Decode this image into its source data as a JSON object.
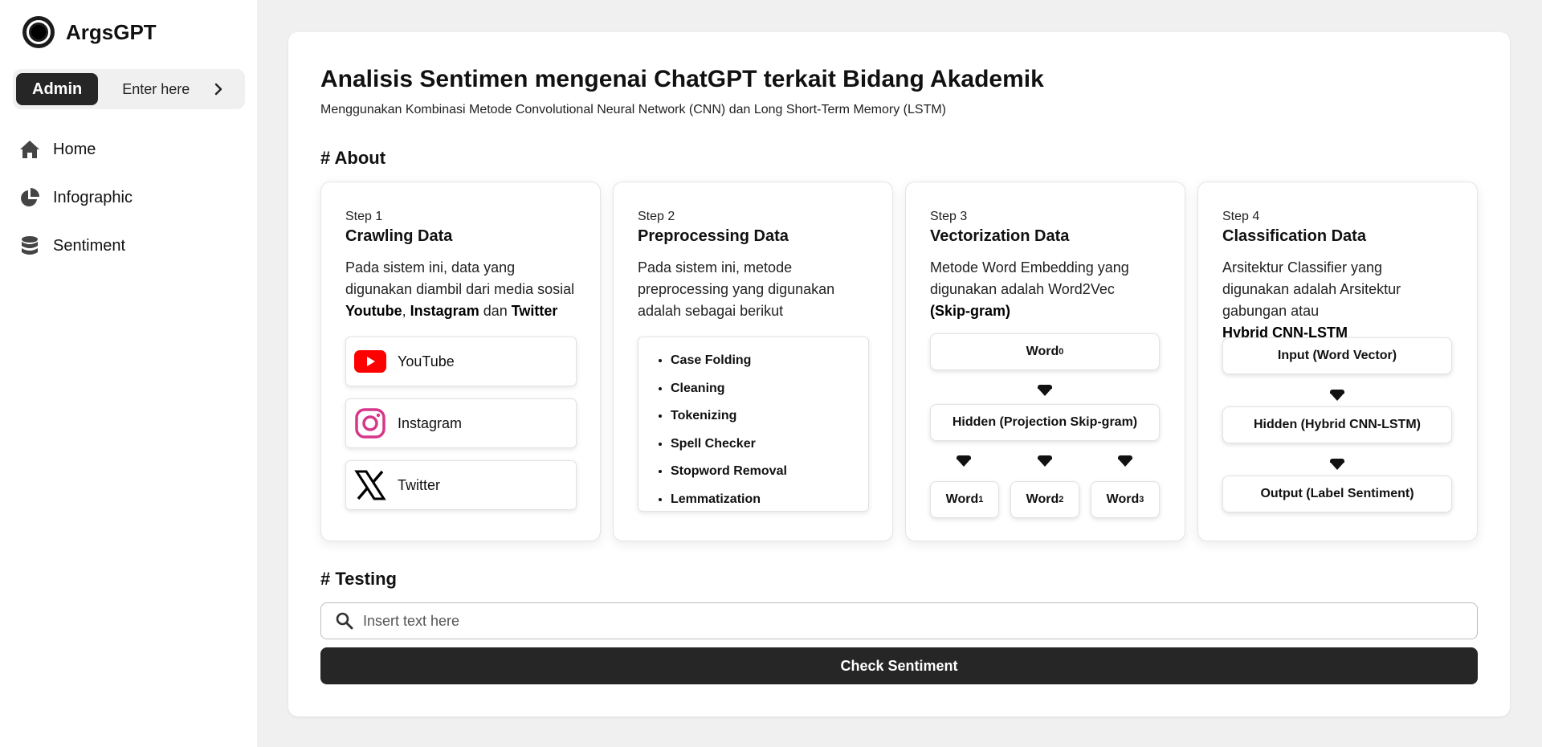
{
  "app": {
    "name": "ArgsGPT"
  },
  "admin_bar": {
    "role": "Admin",
    "enter_label": "Enter here"
  },
  "nav": {
    "items": [
      {
        "label": "Home",
        "icon": "home-icon"
      },
      {
        "label": "Infographic",
        "icon": "pie-chart-icon"
      },
      {
        "label": "Sentiment",
        "icon": "database-icon"
      }
    ]
  },
  "page": {
    "title": "Analisis Sentimen mengenai ChatGPT terkait Bidang Akademik",
    "subtitle": "Menggunakan Kombinasi Metode Convolutional Neural Network (CNN) dan Long Short-Term Memory (LSTM)",
    "about_heading": "# About",
    "testing_heading": "# Testing"
  },
  "steps": [
    {
      "num": "Step 1",
      "title": "Crawling Data",
      "desc_parts": [
        "Pada sistem ini, data yang digunakan diambil dari media sosial ",
        "Youtube",
        ", ",
        "Instagram",
        " dan ",
        "Twitter"
      ],
      "socials": [
        {
          "label": "YouTube",
          "icon": "youtube-icon",
          "color": "#ff0000"
        },
        {
          "label": "Instagram",
          "icon": "instagram-icon",
          "color": "#d6378a"
        },
        {
          "label": "Twitter",
          "icon": "x-twitter-icon",
          "color": "#000000"
        }
      ]
    },
    {
      "num": "Step 2",
      "title": "Preprocessing Data",
      "desc": "Pada sistem ini, metode preprocessing yang digunakan adalah sebagai berikut",
      "items": [
        "Case Folding",
        "Cleaning",
        "Tokenizing",
        "Spell Checker",
        "Stopword Removal",
        "Lemmatization"
      ]
    },
    {
      "num": "Step 3",
      "title": "Vectorization Data",
      "desc": "Metode Word Embedding yang digunakan adalah Word2Vec",
      "desc_bold": "(Skip-gram)",
      "nodes": {
        "input": "Word",
        "input_sub": "0",
        "hidden": "Hidden (Projection Skip-gram)",
        "outputs": [
          {
            "w": "Word",
            "s": "1"
          },
          {
            "w": "Word",
            "s": "2"
          },
          {
            "w": "Word",
            "s": "3"
          }
        ]
      }
    },
    {
      "num": "Step 4",
      "title": "Classification Data",
      "desc": "Arsitektur Classifier yang digunakan adalah Arsitektur gabungan atau",
      "desc_bold": "Hybrid CNN-LSTM",
      "layers": [
        "Input (Word Vector)",
        "Hidden (Hybrid CNN-LSTM)",
        "Output (Label Sentiment)"
      ]
    }
  ],
  "testing": {
    "placeholder": "Insert text here",
    "button_label": "Check Sentiment"
  }
}
